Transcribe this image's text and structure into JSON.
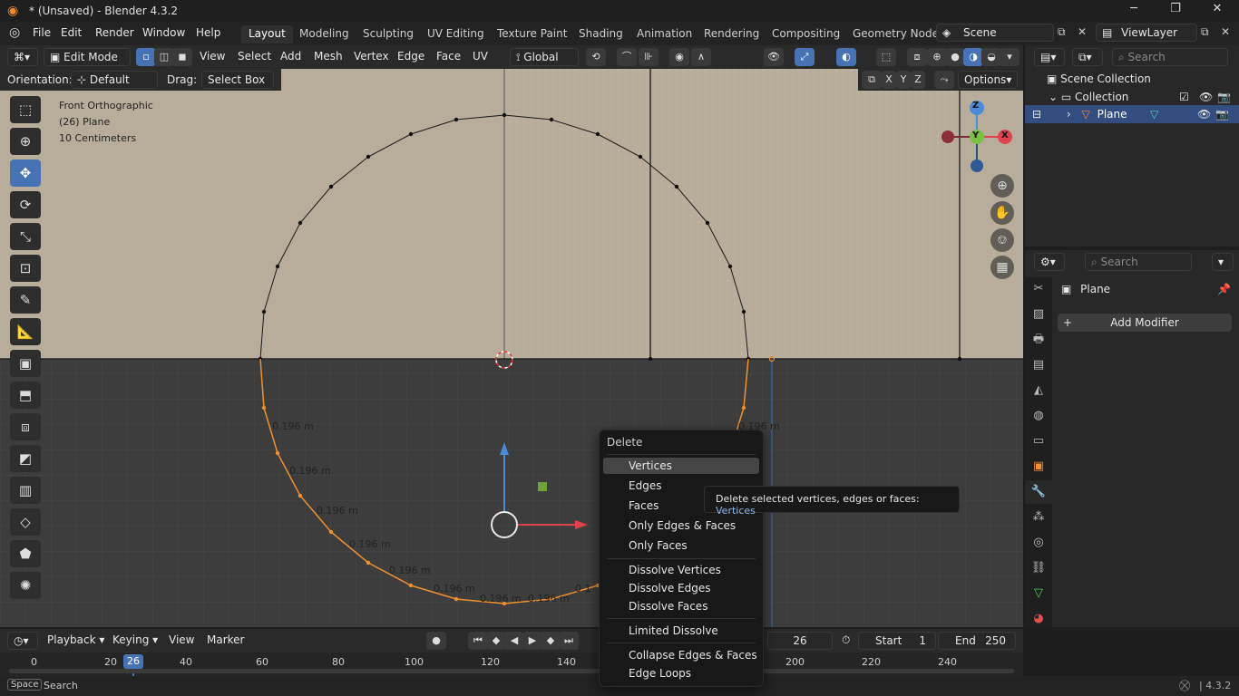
{
  "titlebar": {
    "title": "* (Unsaved) - Blender 4.3.2"
  },
  "menus": [
    "File",
    "Edit",
    "Render",
    "Window",
    "Help"
  ],
  "workspaces": [
    "Layout",
    "Modeling",
    "Sculpting",
    "UV Editing",
    "Texture Paint",
    "Shading",
    "Animation",
    "Rendering",
    "Compositing",
    "Geometry Node"
  ],
  "scene": {
    "name": "Scene",
    "view_layer": "ViewLayer"
  },
  "viewport_header": {
    "mode": "Edit Mode",
    "menus": [
      "View",
      "Select",
      "Add",
      "Mesh",
      "Vertex",
      "Edge",
      "Face",
      "UV"
    ],
    "transform_orientation": "Global",
    "orientation_label": "Orientation:",
    "orientation_value": "Default",
    "drag_label": "Drag:",
    "drag_value": "Select Box",
    "axes": [
      "X",
      "Y",
      "Z"
    ],
    "options": "Options"
  },
  "overlay_info": {
    "view": "Front Orthographic",
    "object": "(26) Plane",
    "scale": "10 Centimeters"
  },
  "edge_lengths": [
    "0.196 m",
    "0.196 m",
    "0.196 m",
    "0.196 m",
    "0.196 m",
    "0.196 m",
    "0.196 m",
    "0.196 m",
    "0.196 m",
    "0.1",
    "0.196 m"
  ],
  "gizmo": {
    "z": "Z",
    "y": "Y",
    "x": "X"
  },
  "outliner": {
    "search_placeholder": "Search",
    "scene_collection": "Scene Collection",
    "collection": "Collection",
    "object": "Plane"
  },
  "properties": {
    "search_placeholder": "Search",
    "object": "Plane",
    "add_modifier": "Add Modifier"
  },
  "delete_menu": {
    "title": "Delete",
    "groups": [
      [
        "Vertices",
        "Edges",
        "Faces",
        "Only Edges & Faces",
        "Only Faces"
      ],
      [
        "Dissolve Vertices",
        "Dissolve Edges",
        "Dissolve Faces"
      ],
      [
        "Limited Dissolve"
      ],
      [
        "Collapse Edges & Faces",
        "Edge Loops"
      ]
    ]
  },
  "tooltip": {
    "text": "Delete selected vertices, edges or faces: ",
    "value": "Vertices"
  },
  "timeline": {
    "menus": [
      "Playback",
      "Keying",
      "View",
      "Marker"
    ],
    "current_frame": "26",
    "start_label": "Start",
    "start": "1",
    "end_label": "End",
    "end": "250",
    "ticks": [
      "0",
      "20",
      "26",
      "40",
      "60",
      "80",
      "100",
      "120",
      "140",
      "200",
      "220",
      "240"
    ]
  },
  "statusbar": {
    "key": "Space",
    "action": "Search",
    "version": "4.3.2"
  },
  "colors": {
    "accent": "#4772b3",
    "selected_edge": "#f0902e",
    "background_image": "#b8ad9a"
  }
}
